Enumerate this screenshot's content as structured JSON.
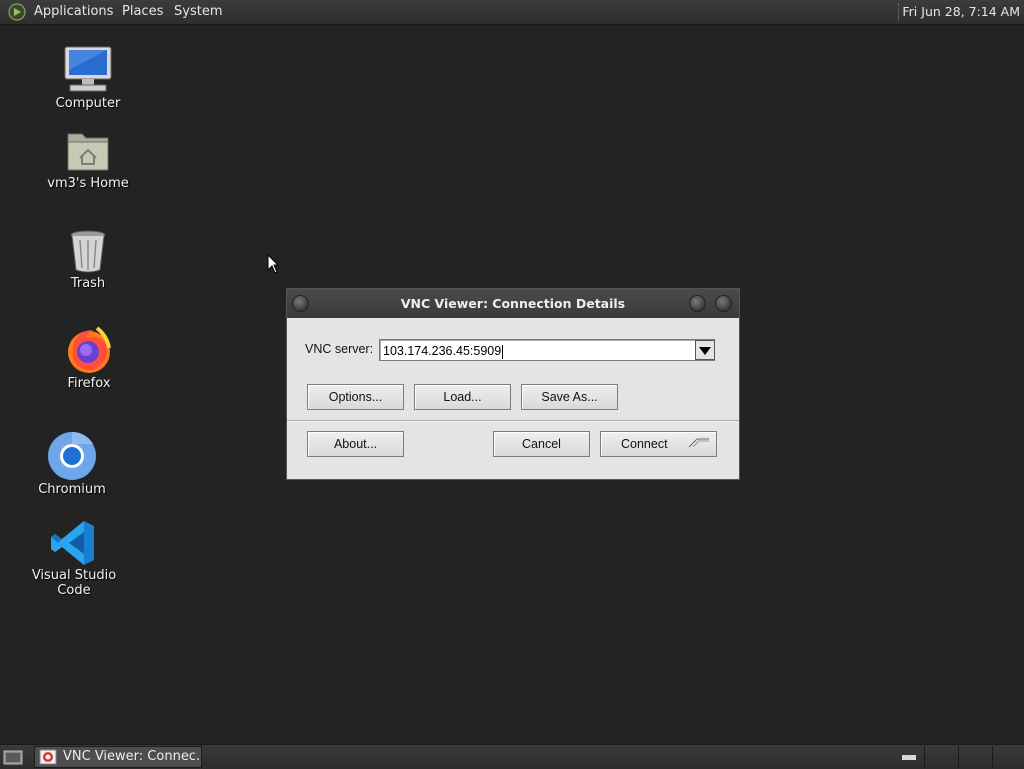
{
  "top_panel": {
    "menu": [
      "Applications",
      "Places",
      "System"
    ],
    "clock": "Fri Jun 28,  7:14 AM"
  },
  "desktop_icons": [
    {
      "label": "Computer",
      "icon": "computer-icon"
    },
    {
      "label": "vm3's Home",
      "icon": "home-folder-icon"
    },
    {
      "label": "Trash",
      "icon": "trash-icon"
    },
    {
      "label": "Firefox",
      "icon": "firefox-icon"
    },
    {
      "label": "Chromium",
      "icon": "chromium-icon"
    },
    {
      "label": "Visual Studio Code",
      "icon": "vscode-icon"
    }
  ],
  "dialog": {
    "title": "VNC Viewer: Connection Details",
    "server_label": "VNC server:",
    "server_value": "103.174.236.45:5909",
    "buttons": {
      "options": "Options...",
      "load": "Load...",
      "save_as": "Save As...",
      "about": "About...",
      "cancel": "Cancel",
      "connect": "Connect"
    }
  },
  "taskbar": {
    "task_label": "VNC Viewer: Connec..."
  },
  "colors": {
    "desktop_bg": "#232323",
    "panel_bg": "#333333",
    "dialog_bg": "#e4e4e4",
    "titlebar_bg": "#424242"
  }
}
